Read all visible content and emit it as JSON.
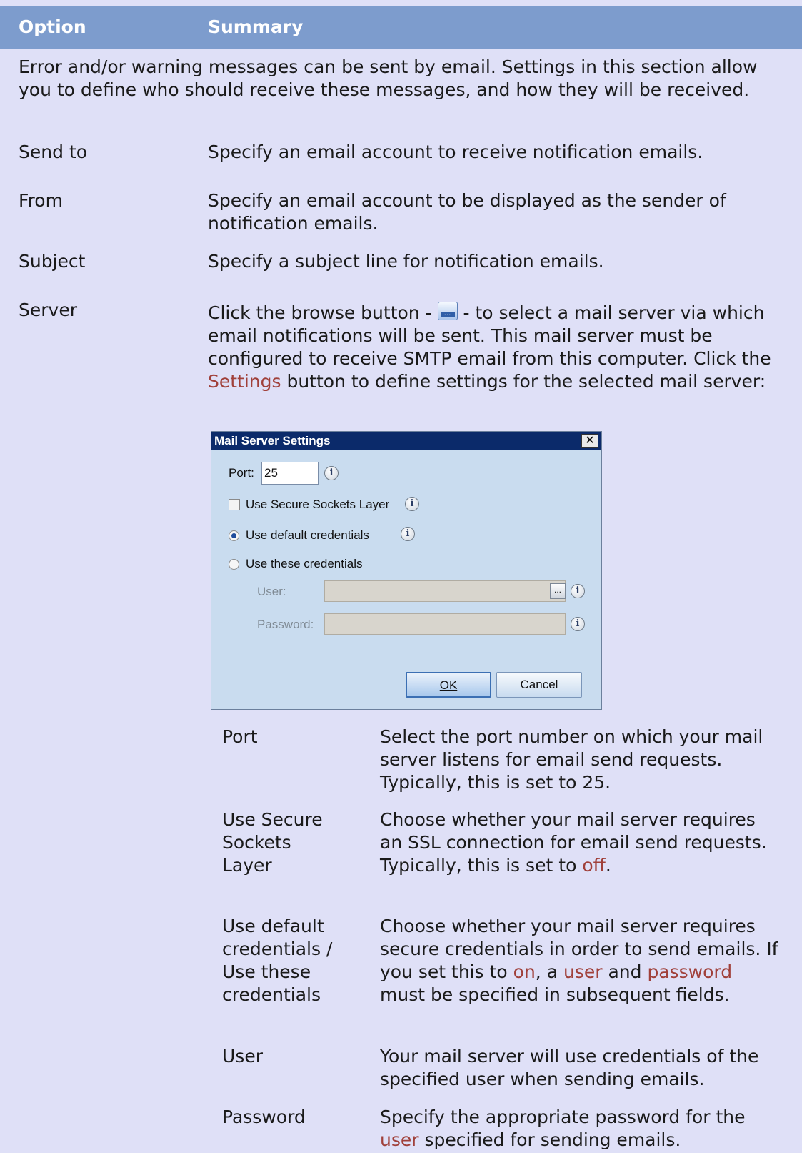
{
  "header": {
    "col_option": "Option",
    "col_summary": "Summary"
  },
  "intro": "Error and/or warning messages can be sent by email. Settings in this section allow you to define who should receive these messages, and how they will be received.",
  "rows": [
    {
      "label": "Send to",
      "text": "Specify an email account to receive notification emails."
    },
    {
      "label": "From",
      "text": "Specify an email account to be displayed as the sender of notification emails."
    },
    {
      "label": "Subject",
      "text": "Specify a subject line for notification emails."
    }
  ],
  "server": {
    "label": "Server",
    "text_a": "Click the browse button - ",
    "text_b": " - to select a mail server via which email notifications will be sent. This mail server must be configured to receive SMTP email from this computer. Click the ",
    "text_link": "Settings",
    "text_c": " button to define settings for the selected mail server:"
  },
  "dialog": {
    "title": "Mail Server Settings",
    "close": "✕",
    "port_label": "Port:",
    "port_value": "25",
    "ssl_label": "Use Secure Sockets Layer",
    "default_cred_label": "Use default credentials",
    "these_cred_label": "Use these credentials",
    "user_label": "User:",
    "password_label": "Password:",
    "browse_glyph": "...",
    "info_glyph": "i",
    "ok_label": "OK",
    "cancel_label": "Cancel"
  },
  "sub_rows": [
    {
      "label": "Port",
      "text": "Select the port number on which your mail server listens for email send requests. Typically, this is set to 25."
    },
    {
      "label": "Use Secure Sockets Layer",
      "text_a": "Choose whether your mail server requires an SSL connection for email send requests. Typically, this is set to ",
      "text_link": "off",
      "text_b": "."
    },
    {
      "label": "Use default credentials / Use these credentials",
      "text_a": "Choose whether your mail server requires secure credentials in order to send emails. If you set this to ",
      "link_on": "on",
      "text_b": ", a ",
      "link_user": "user",
      "text_c": " and ",
      "link_password": "password",
      "text_d": " must be specified in subsequent fields."
    },
    {
      "label": "User",
      "text": "Your mail server will use credentials of the specified user when sending emails."
    },
    {
      "label": "Password",
      "text_a": "Specify the appropriate password for the ",
      "link_user": "user",
      "text_b": " specified for sending emails."
    }
  ],
  "colors": {
    "header_bg": "#7d9ccd",
    "page_bg": "#dfe0f7",
    "link": "#a0403a",
    "dialog_title": "#0b2a6a"
  }
}
